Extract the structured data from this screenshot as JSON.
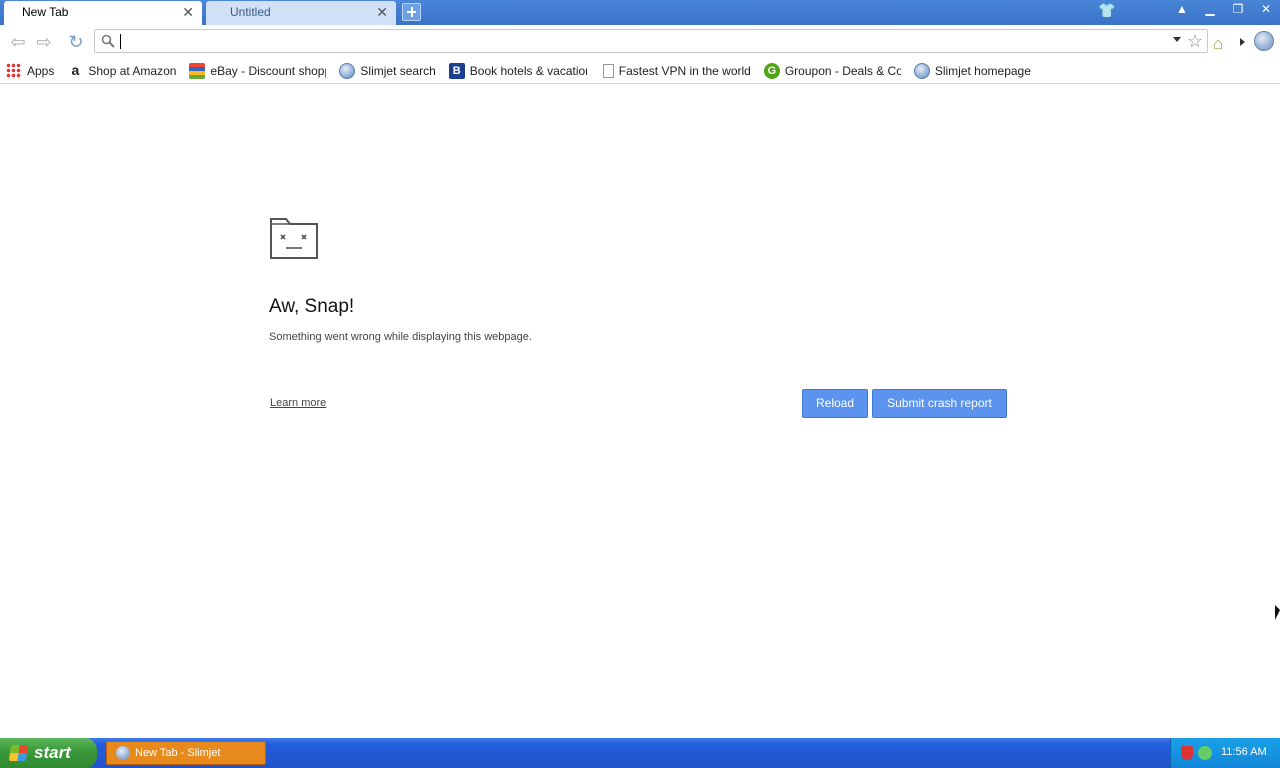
{
  "tabs": [
    {
      "label": "New Tab",
      "active": true
    },
    {
      "label": "Untitled",
      "active": false
    }
  ],
  "window_controls": [
    "shirt-icon",
    "user-icon",
    "minimize",
    "restore",
    "close"
  ],
  "toolbar": {
    "address_value": "",
    "address_placeholder": ""
  },
  "bookmarks": [
    {
      "label": "Apps",
      "icon": "apps-grid-icon"
    },
    {
      "label": "Shop at Amazon",
      "icon": "amazon-icon"
    },
    {
      "label": "eBay - Discount shoppin",
      "icon": "ebay-icon"
    },
    {
      "label": "Slimjet search",
      "icon": "globe-icon"
    },
    {
      "label": "Book hotels & vacation r",
      "icon": "booking-icon"
    },
    {
      "label": "Fastest VPN in the world",
      "icon": "page-icon"
    },
    {
      "label": "Groupon - Deals & Coup",
      "icon": "groupon-icon"
    },
    {
      "label": "Slimjet homepage",
      "icon": "globe-icon"
    }
  ],
  "error": {
    "title": "Aw, Snap!",
    "message": "Something went wrong while displaying this webpage.",
    "learn_more": "Learn more",
    "reload": "Reload",
    "submit": "Submit crash report"
  },
  "taskbar": {
    "start": "start",
    "task": "New Tab - Slimjet",
    "clock": "11:56 AM"
  },
  "colors": {
    "accent": "#5b93ee",
    "tabstrip": "#3a72c8",
    "taskbar": "#245edb",
    "task_active": "#e8891c"
  }
}
